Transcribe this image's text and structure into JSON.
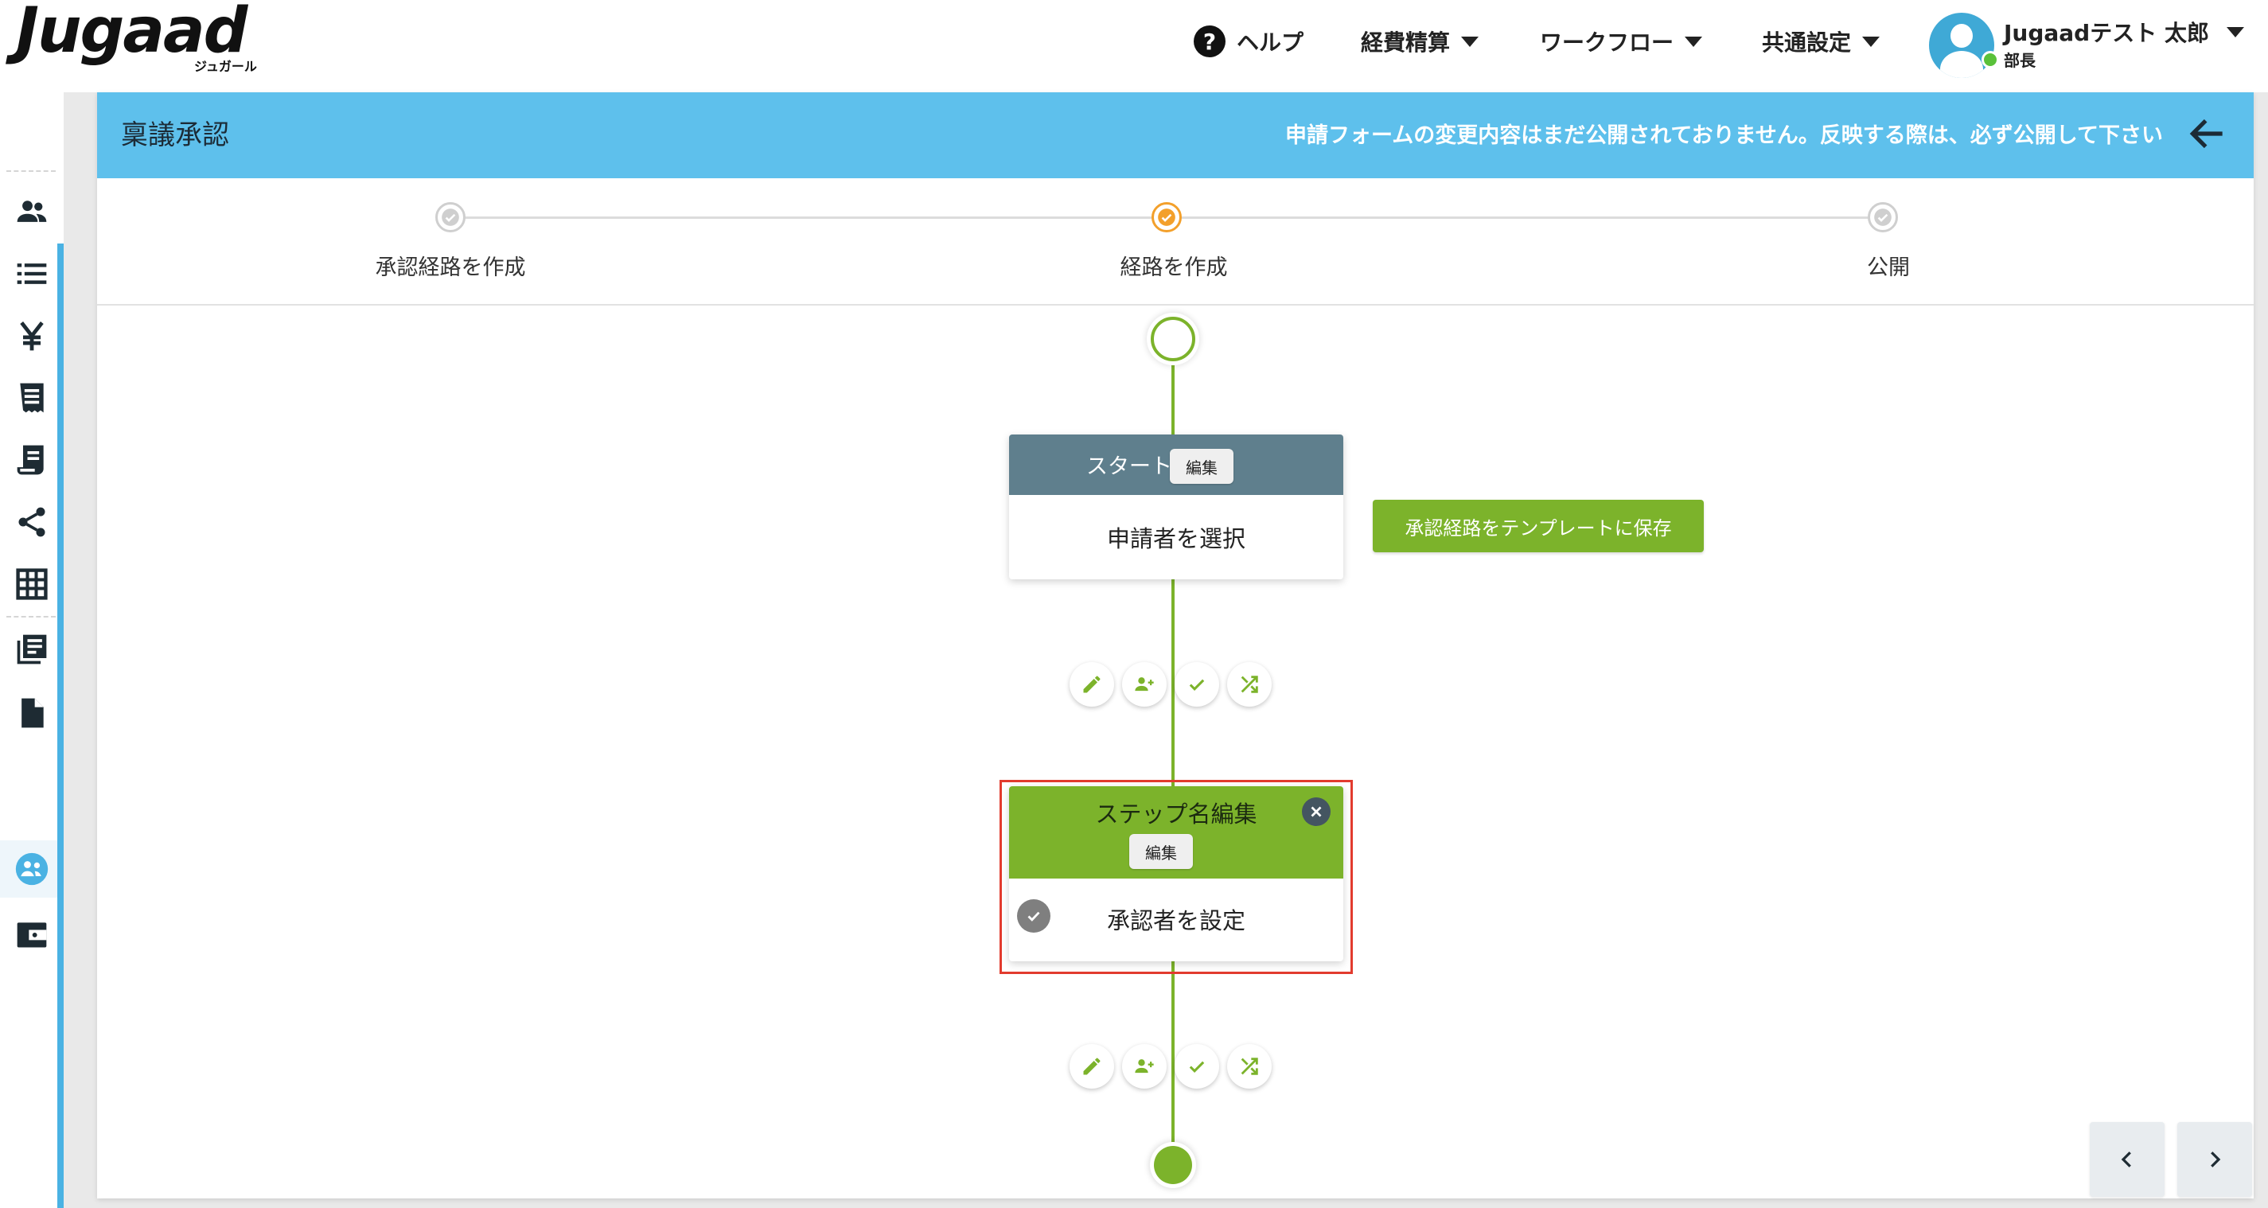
{
  "header": {
    "logo_text": "Jugaad",
    "logo_sub": "ジュガール",
    "nav": [
      {
        "label": "ヘルプ"
      },
      {
        "label": "経費精算"
      },
      {
        "label": "ワークフロー"
      },
      {
        "label": "共通設定"
      }
    ],
    "user": {
      "name": "Jugaadテスト 太郎",
      "role": "部長"
    }
  },
  "sidebar": {
    "items": [
      {
        "icon": "users-icon"
      },
      {
        "icon": "list-icon"
      },
      {
        "icon": "yen-icon"
      },
      {
        "icon": "receipt-icon"
      },
      {
        "icon": "invoice-icon"
      },
      {
        "icon": "share-icon"
      },
      {
        "icon": "grid-icon"
      },
      {
        "icon": "library-icon"
      },
      {
        "icon": "document-icon"
      },
      {
        "icon": "workflow-icon",
        "active": true
      },
      {
        "icon": "wallet-icon"
      }
    ]
  },
  "page": {
    "title": "稟議承認",
    "notice": "申請フォームの変更内容はまだ公開されておりません。反映する際は、必ず公開して下さい"
  },
  "stepper": {
    "steps": [
      {
        "label": "承認経路を作成",
        "state": "done"
      },
      {
        "label": "経路を作成",
        "state": "active"
      },
      {
        "label": "公開",
        "state": "pending"
      }
    ]
  },
  "flow": {
    "start_card": {
      "title": "スタート",
      "edit_label": "編集",
      "body": "申請者を選択"
    },
    "save_template_label": "承認経路をテンプレートに保存",
    "step_card": {
      "title": "ステップ名編集",
      "edit_label": "編集",
      "body": "承認者を設定"
    },
    "action_buttons": [
      "pencil-icon",
      "add-user-icon",
      "check-icon",
      "shuffle-icon"
    ]
  },
  "colors": {
    "accent_green": "#7cb32b",
    "header_blue": "#5ec0ec",
    "start_head": "#5f7f8d",
    "active_step": "#f3a02b",
    "selection": "#e23b2e"
  }
}
